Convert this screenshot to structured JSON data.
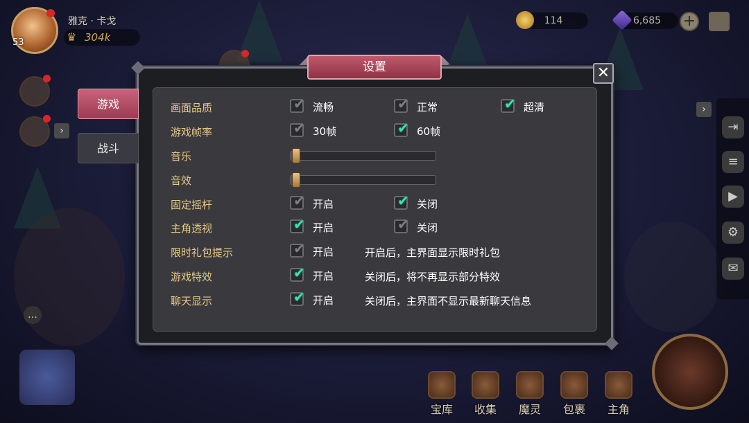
{
  "player": {
    "name": "雅克 · 卡戈",
    "level": "53",
    "power": "304k"
  },
  "currency": {
    "gold": "114",
    "gems": "6,685"
  },
  "dialog": {
    "title": "设置",
    "close": "✕",
    "tabs": [
      {
        "label": "游戏"
      },
      {
        "label": "战斗"
      }
    ]
  },
  "settings": {
    "quality": {
      "label": "画面品质",
      "options": [
        {
          "text": "流畅",
          "checked": false
        },
        {
          "text": "正常",
          "checked": false
        },
        {
          "text": "超清",
          "checked": true
        }
      ]
    },
    "framerate": {
      "label": "游戏帧率",
      "options": [
        {
          "text": "30帧",
          "checked": false
        },
        {
          "text": "60帧",
          "checked": true
        }
      ]
    },
    "music": {
      "label": "音乐",
      "level": 0.02
    },
    "sfx": {
      "label": "音效",
      "level": 0.02
    },
    "joystick": {
      "label": "固定摇杆",
      "options": [
        {
          "text": "开启",
          "checked": false
        },
        {
          "text": "关闭",
          "checked": true
        }
      ]
    },
    "perspective": {
      "label": "主角透视",
      "options": [
        {
          "text": "开启",
          "checked": true
        },
        {
          "text": "关闭",
          "checked": false
        }
      ]
    },
    "giftpack": {
      "label": "限时礼包提示",
      "options": [
        {
          "text": "开启",
          "checked": false
        }
      ],
      "note": "开启后，主界面显示限时礼包"
    },
    "effects": {
      "label": "游戏特效",
      "options": [
        {
          "text": "开启",
          "checked": true
        }
      ],
      "note": "关闭后，将不再显示部分特效"
    },
    "chat": {
      "label": "聊天显示",
      "options": [
        {
          "text": "开启",
          "checked": true
        }
      ],
      "note": "关闭后，主界面不显示最新聊天信息"
    }
  },
  "bottom_nav": [
    {
      "label": "宝库"
    },
    {
      "label": "收集"
    },
    {
      "label": "魔灵"
    },
    {
      "label": "包裹"
    },
    {
      "label": "主角"
    }
  ],
  "colors": {
    "accent": "#c05a6c",
    "check_on": "#3be0b4",
    "label": "#e8c986"
  }
}
